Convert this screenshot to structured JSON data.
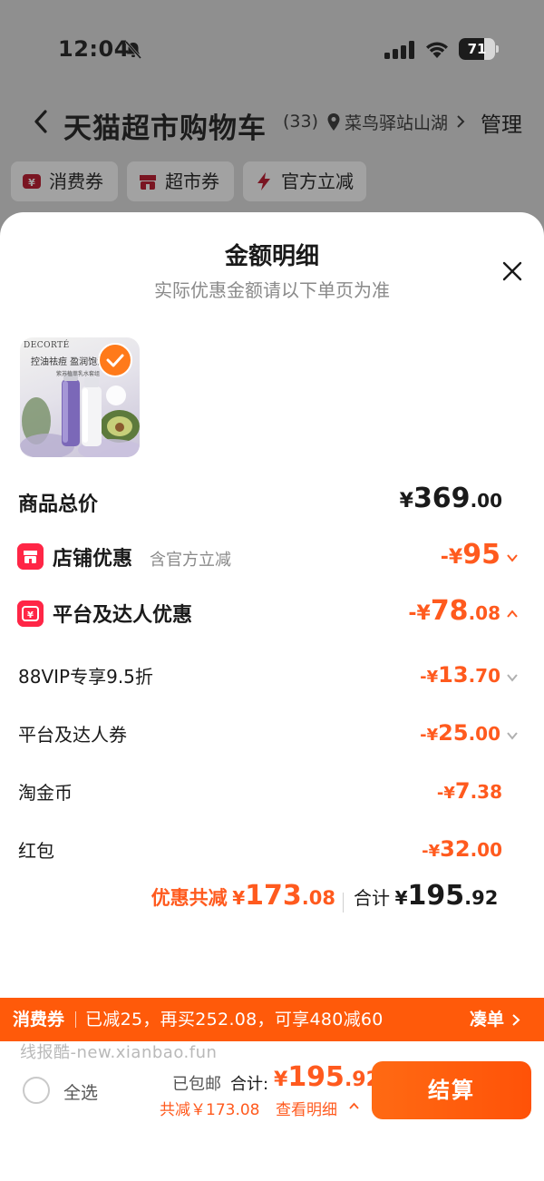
{
  "status_bar": {
    "time": "12:04",
    "battery": "71",
    "battery_level": 0.71
  },
  "nav": {
    "title": "天猫超市购物车",
    "count": "(33)",
    "location": "菜鸟驿站山湖",
    "manage": "管理"
  },
  "chips": [
    {
      "label": "消费券",
      "icon": "coupon-icon"
    },
    {
      "label": "超市券",
      "icon": "store-icon"
    },
    {
      "label": "官方立减",
      "icon": "lightning-icon"
    }
  ],
  "sheet": {
    "title": "金额明细",
    "subtitle": "实际优惠金额请以下单页为准"
  },
  "product": {
    "brand": "DECORTÉ",
    "tagline": "控油祛痘 盈润饱满",
    "subline": "紫苏植萃乳水套组"
  },
  "rows": {
    "total_price": {
      "label": "商品总价",
      "yen": "¥",
      "int": "369",
      "dec": ".00"
    },
    "store_discount": {
      "label": "店铺优惠",
      "note": "含官方立减",
      "prefix": "-¥",
      "int": "95",
      "dec": ""
    },
    "platform_discount": {
      "label": "平台及达人优惠",
      "prefix": "-¥",
      "int": "78",
      "dec": ".08"
    },
    "vip": {
      "label": "88VIP专享9.5折",
      "prefix": "-¥",
      "int": "13",
      "dec": ".70"
    },
    "platform_coupon": {
      "label": "平台及达人券",
      "prefix": "-¥",
      "int": "25",
      "dec": ".00"
    },
    "taojinbi": {
      "label": "淘金币",
      "prefix": "-¥",
      "int": "7",
      "dec": ".38"
    },
    "red_packet": {
      "label": "红包",
      "prefix": "-¥",
      "int": "32",
      "dec": ".00"
    }
  },
  "summary": {
    "discount_label": "优惠共减",
    "discount_yen": "¥",
    "discount_int": "173",
    "discount_dec": ".08",
    "total_label": "合计",
    "total_yen": "¥",
    "total_int": "195",
    "total_dec": ".92"
  },
  "promo": {
    "tag": "消费券",
    "text": "已减25，再买252.08，可享480减60",
    "action": "凑单"
  },
  "watermark": "线报酷-new.xianbao.fun",
  "checkout": {
    "select_all": "全选",
    "shipping": "已包邮",
    "total_label": "合计:",
    "total_yen": "¥",
    "total_int": "195",
    "total_dec": ".92",
    "saved": "共减￥173.08",
    "view_detail": "查看明细",
    "button": "结算"
  },
  "colors": {
    "accent": "#ff5a1e",
    "badge_red": "#ff2646",
    "banner": "#ff5a0a"
  }
}
